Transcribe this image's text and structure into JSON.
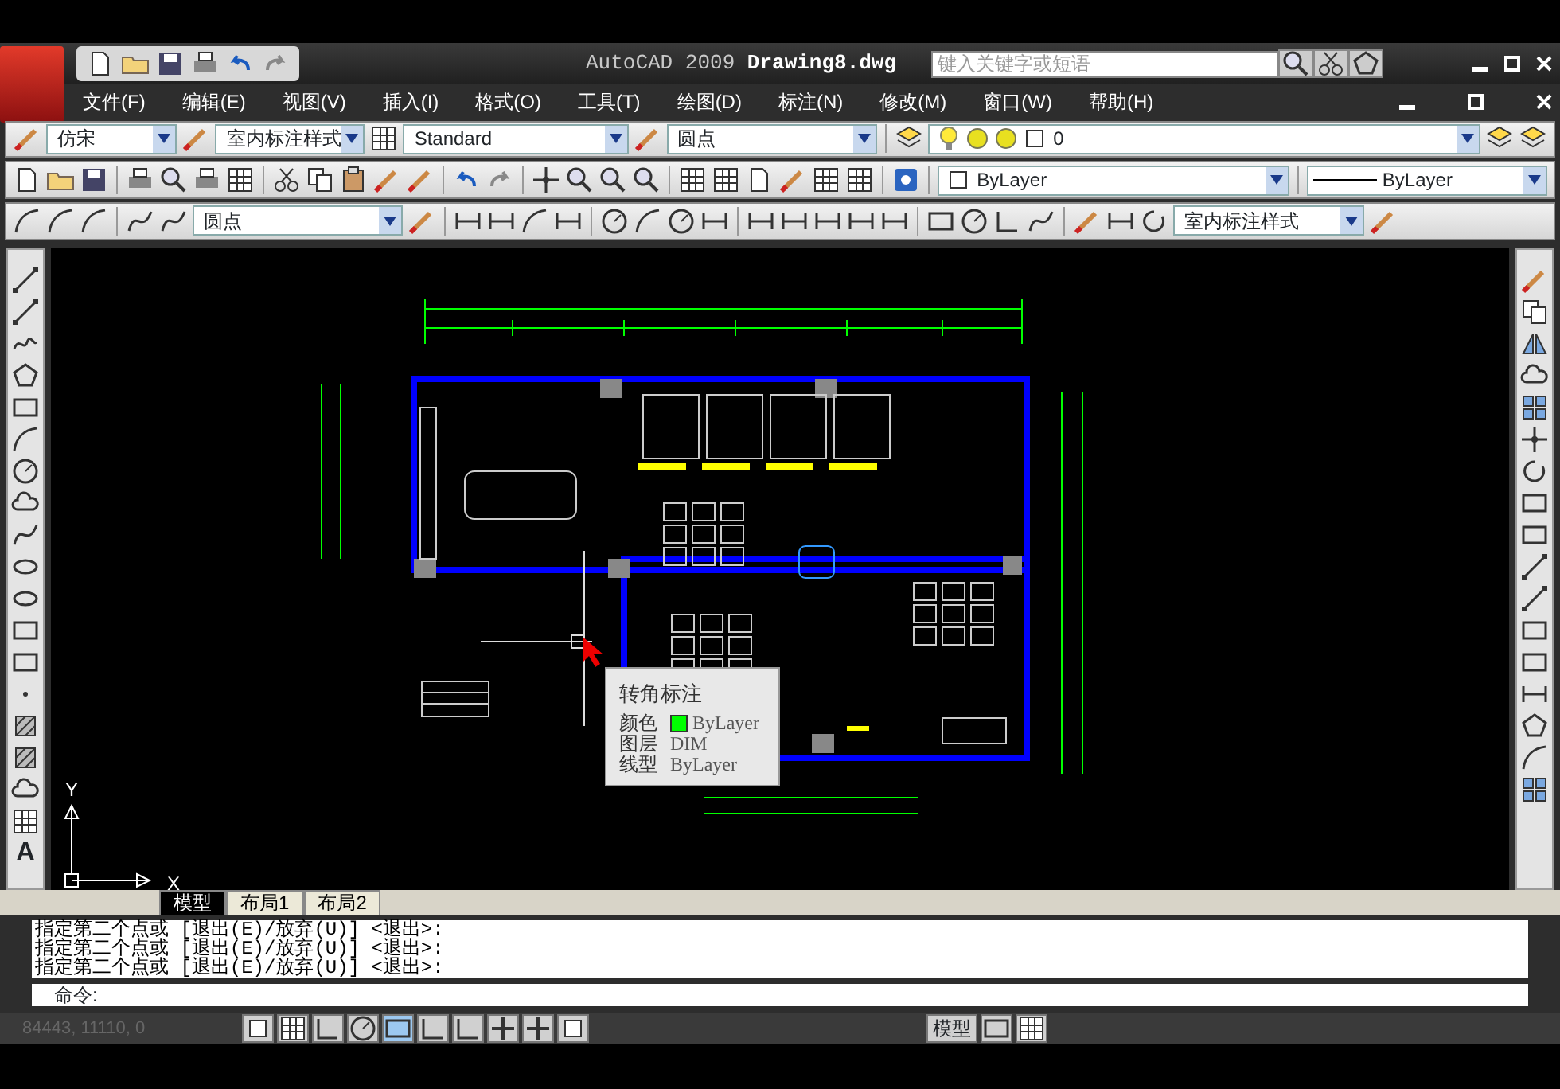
{
  "title_bar": {
    "app_name": "AutoCAD 2009",
    "document": "Drawing8.dwg",
    "search": {
      "placeholder": "键入关键字或短语"
    }
  },
  "menu": [
    "文件(F)",
    "编辑(E)",
    "视图(V)",
    "插入(I)",
    "格式(O)",
    "工具(T)",
    "绘图(D)",
    "标注(N)",
    "修改(M)",
    "窗口(W)",
    "帮助(H)"
  ],
  "styles_toolbar": {
    "text_style": "仿宋",
    "dim_style": "室内标注样式",
    "table_style": "Standard",
    "multileader_style": "圆点",
    "layer": "0"
  },
  "properties_toolbar": {
    "color_setting": "ByLayer",
    "linetype": "ByLayer"
  },
  "dimension_toolbar": {
    "multileader_style": "圆点",
    "dim_style": "室内标注样式"
  },
  "draw_toolbar": {
    "text_tool": "A"
  },
  "tooltip": {
    "title": "转角标注",
    "rows": [
      {
        "label": "颜色",
        "value": "ByLayer",
        "color": "#00ff00"
      },
      {
        "label": "图层",
        "value": "DIM"
      },
      {
        "label": "线型",
        "value": "ByLayer"
      }
    ]
  },
  "ucs": {
    "x": "X",
    "y": "Y"
  },
  "layout_tabs": [
    {
      "label": "模型",
      "selected": true
    },
    {
      "label": "布局1",
      "selected": false
    },
    {
      "label": "布局2",
      "selected": false
    }
  ],
  "command_history": [
    "指定第二个点或 [退出(E)/放弃(U)] <退出>:",
    "指定第二个点或 [退出(E)/放弃(U)] <退出>:",
    "指定第二个点或 [退出(E)/放弃(U)] <退出>:"
  ],
  "command_prompt": "命令:",
  "status_bar": {
    "coordinates": "84443, 11110, 0",
    "toggles": [
      {
        "on": false
      },
      {
        "on": false
      },
      {
        "on": false
      },
      {
        "on": false
      },
      {
        "on": true
      },
      {
        "on": false
      },
      {
        "on": false
      },
      {
        "on": false
      },
      {
        "on": false
      },
      {
        "on": false
      }
    ],
    "space": "模型"
  }
}
